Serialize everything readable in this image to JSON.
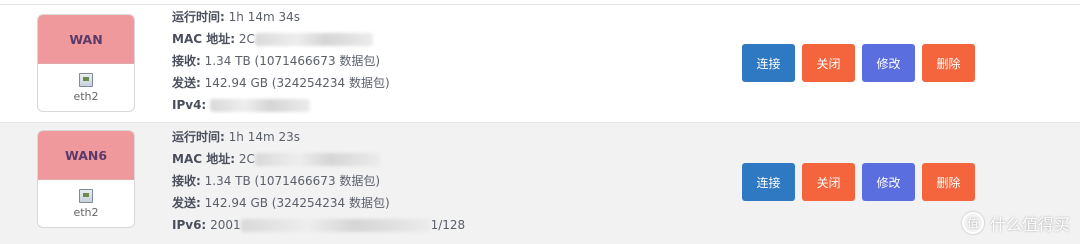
{
  "interfaces": [
    {
      "name": "WAN",
      "device": "eth2",
      "uptime_label": "运行时间:",
      "uptime": "1h 14m 34s",
      "mac_label": "MAC 地址:",
      "mac_visible": "2C",
      "rx_label": "接收:",
      "rx": "1.34 TB (1071466673 数据包)",
      "tx_label": "发送:",
      "tx": "142.94 GB (324254234 数据包)",
      "ip_label": "IPv4:",
      "ip_prefix": "",
      "ip_suffix": ""
    },
    {
      "name": "WAN6",
      "device": "eth2",
      "uptime_label": "运行时间:",
      "uptime": "1h 14m 23s",
      "mac_label": "MAC 地址:",
      "mac_visible": "2C",
      "rx_label": "接收:",
      "rx": "1.34 TB (1071466673 数据包)",
      "tx_label": "发送:",
      "tx": "142.94 GB (324254234 数据包)",
      "ip_label": "IPv6:",
      "ip_prefix": "2001",
      "ip_suffix": "1/128"
    }
  ],
  "buttons": {
    "connect": "连接",
    "close": "关闭",
    "edit": "修改",
    "delete": "删除"
  },
  "colors": {
    "badge_header": "#f0999c",
    "connect": "#2f78c2",
    "close": "#f4653e",
    "edit": "#5b6ee0",
    "delete": "#f4653e"
  },
  "watermark": {
    "icon": "值",
    "text": "什么值得买"
  }
}
